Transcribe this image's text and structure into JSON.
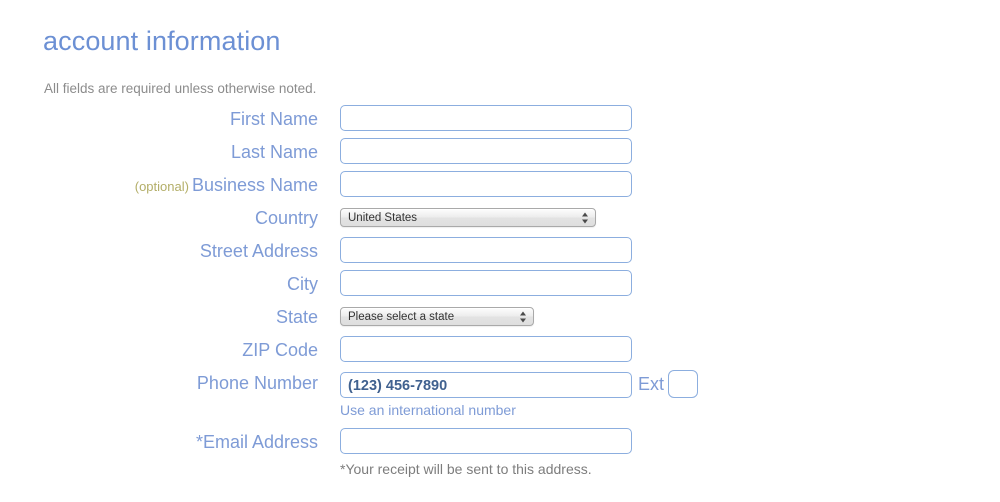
{
  "header": {
    "title": "account information",
    "subtitle": "All fields are required unless otherwise noted."
  },
  "form": {
    "fields": {
      "first_name": {
        "label": "First Name",
        "value": "",
        "placeholder": ""
      },
      "last_name": {
        "label": "Last Name",
        "value": "",
        "placeholder": ""
      },
      "business_name": {
        "label": "Business Name",
        "optional_tag": "(optional)",
        "value": "",
        "placeholder": ""
      },
      "country": {
        "label": "Country",
        "selected": "United States"
      },
      "street_address": {
        "label": "Street Address",
        "value": "",
        "placeholder": ""
      },
      "city": {
        "label": "City",
        "value": "",
        "placeholder": ""
      },
      "state": {
        "label": "State",
        "selected": "Please select a state"
      },
      "zip_code": {
        "label": "ZIP Code",
        "value": "",
        "placeholder": ""
      },
      "phone_number": {
        "label": "Phone Number",
        "value": "",
        "placeholder": "(123) 456-7890",
        "ext_label": "Ext",
        "ext_value": "",
        "helper": "Use an international number"
      },
      "email_address": {
        "label": "*Email Address",
        "value": "",
        "placeholder": "",
        "helper": "*Your receipt will be sent to this address."
      }
    }
  },
  "colors": {
    "title_blue": "#6c90d4",
    "label_blue": "#7e9bd6",
    "optional_olive": "#b3ae68",
    "input_border": "#8caedf",
    "muted_text": "#8c8c8c",
    "page_background": "#ffffff"
  }
}
